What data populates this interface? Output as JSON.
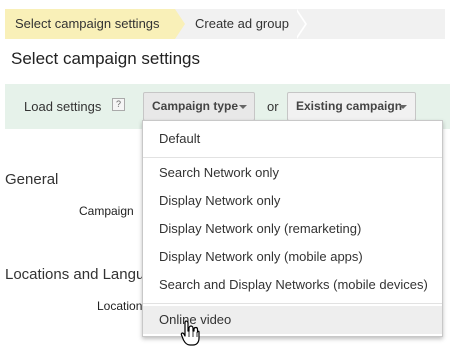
{
  "breadcrumb": {
    "active": "Select campaign settings",
    "next": "Create ad group"
  },
  "page_title": "Select campaign settings",
  "load_settings": {
    "label": "Load settings",
    "help": "?",
    "campaign_type_button": "Campaign type",
    "or": "or",
    "existing_campaign_button": "Existing campaign"
  },
  "background": {
    "general_heading": "General",
    "campaign_field": "Campaign",
    "locations_heading": "Locations and Langua",
    "locations_field": "Location"
  },
  "menu": {
    "items": [
      "Default",
      "Search Network only",
      "Display Network only",
      "Display Network only (remarketing)",
      "Display Network only (mobile apps)",
      "Search and Display Networks (mobile devices)",
      "Online video"
    ],
    "hovered_index": 6
  },
  "colors": {
    "breadcrumb_active": "#f9f0b8",
    "load_bar": "#e6f2ea",
    "menu_hover": "#eeeeee"
  }
}
